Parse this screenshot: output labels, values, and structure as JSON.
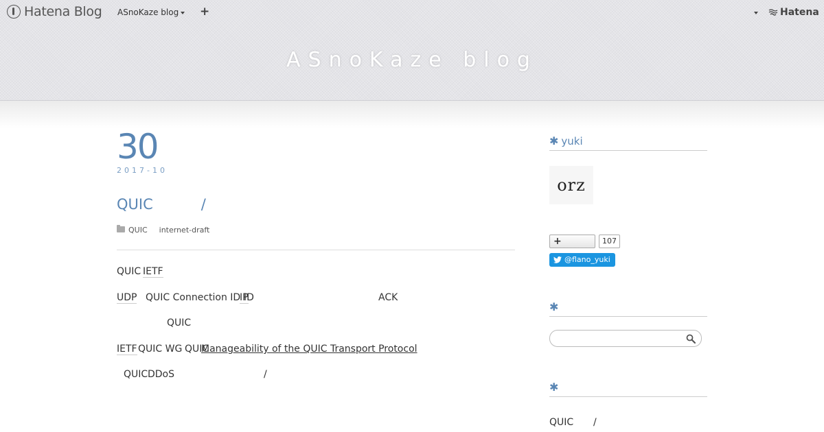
{
  "topbar": {
    "logo_text": "Hatena Blog",
    "blog_select": "ASnoKaze blog",
    "add_button": "+",
    "brand": "Hatena"
  },
  "header": {
    "blog_title": "ASnoKaze blog"
  },
  "entry": {
    "day": "30",
    "year_month": "2017-10",
    "title_a": "QUIC",
    "title_b": "/",
    "categories": [
      "QUIC",
      "internet-draft"
    ],
    "body": {
      "l1_a": "QUIC",
      "l1_b": "IETF",
      "l2_a": "UDP",
      "l2_b": "QUIC Connection ID",
      "l2_c": "IP",
      "l2_d": "ID",
      "l2_e": "ACK",
      "l3_a": "QUIC",
      "l4_a": "IETF",
      "l4_b": "QUIC WG",
      "l4_c": "QUIC",
      "l4_link": "Manageability of the QUIC Transport Protocol",
      "l5_a": "QUIC",
      "l5_b": "DDoS",
      "l5_c": "/"
    }
  },
  "sidebar": {
    "profile_heading": "yuki",
    "avatar_text": "orz",
    "subscribe_label": "+",
    "subscriber_count": "107",
    "twitter_label": "@flano_yuki",
    "search_heading": "",
    "search_placeholder": "",
    "recent_heading": "",
    "recent_a": "QUIC",
    "recent_b": "/"
  },
  "colors": {
    "accent": "#5a86b4",
    "twitter": "#1b95e0",
    "header_bg": "#e4e4e8"
  },
  "icons": [
    "hatena-logo-icon",
    "caret-down-icon",
    "plus-icon",
    "hatena-brand-icon",
    "folder-icon",
    "asterisk-icon",
    "twitter-bird-icon",
    "search-icon"
  ]
}
